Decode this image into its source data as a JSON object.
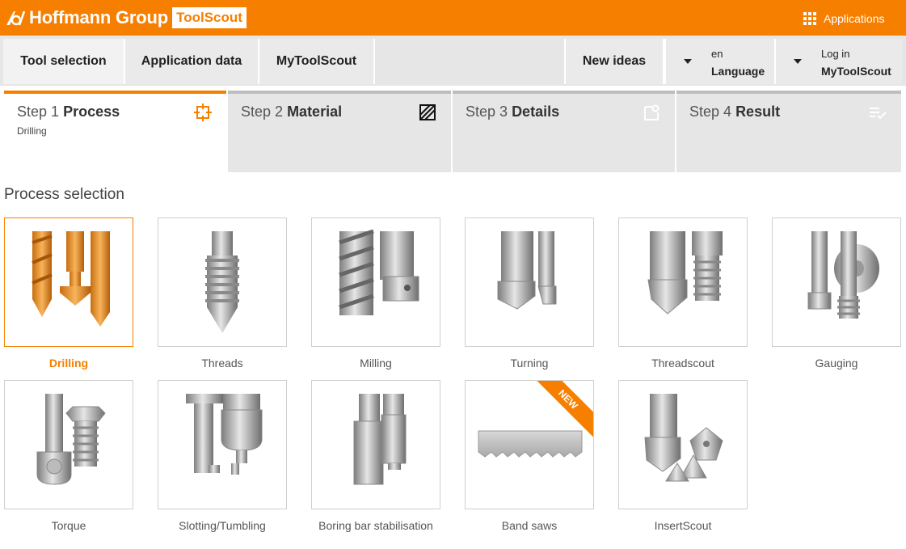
{
  "header": {
    "brand": "Hoffmann Group",
    "product": "ToolScout",
    "applications_label": "Applications"
  },
  "nav": {
    "tool_selection": "Tool selection",
    "application_data": "Application data",
    "mytoolscout": "MyToolScout",
    "new_ideas": "New ideas",
    "language_code": "en",
    "language_label": "Language",
    "login_line1": "Log in",
    "login_line2": "MyToolScout"
  },
  "steps": [
    {
      "prefix": "Step 1",
      "name": "Process",
      "sub": "Drilling",
      "icon": "crosshair-square-icon"
    },
    {
      "prefix": "Step 2",
      "name": "Material",
      "sub": "",
      "icon": "hatched-square-icon"
    },
    {
      "prefix": "Step 3",
      "name": "Details",
      "sub": "",
      "icon": "document-search-icon"
    },
    {
      "prefix": "Step 4",
      "name": "Result",
      "sub": "",
      "icon": "list-check-icon"
    }
  ],
  "section_title": "Process selection",
  "processes": [
    {
      "label": "Drilling",
      "selected": true
    },
    {
      "label": "Threads"
    },
    {
      "label": "Milling"
    },
    {
      "label": "Turning"
    },
    {
      "label": "Threadscout"
    },
    {
      "label": "Gauging"
    },
    {
      "label": "Torque"
    },
    {
      "label": "Slotting/Tumbling"
    },
    {
      "label": "Boring bar stabilisation"
    },
    {
      "label": "Band saws",
      "badge": "NEW"
    },
    {
      "label": "InsertScout"
    }
  ],
  "colors": {
    "accent": "#f77f00",
    "nav_bg": "#e6e6e6"
  }
}
